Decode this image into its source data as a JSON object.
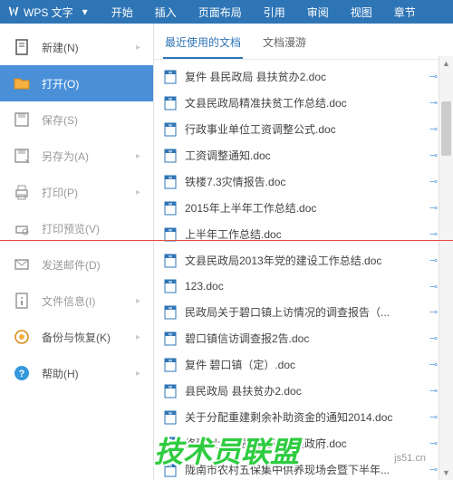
{
  "ribbon": {
    "app_name": "WPS 文字",
    "tabs": [
      "开始",
      "插入",
      "页面布局",
      "引用",
      "审阅",
      "视图",
      "章节"
    ]
  },
  "sidebar": {
    "items": [
      {
        "icon": "new",
        "label": "新建(N)",
        "enabled": true,
        "arrow": true
      },
      {
        "icon": "open",
        "label": "打开(O)",
        "enabled": true,
        "active": true
      },
      {
        "icon": "save",
        "label": "保存(S)",
        "enabled": false,
        "arrow": false
      },
      {
        "icon": "saveas",
        "label": "另存为(A)",
        "enabled": false,
        "arrow": true
      },
      {
        "icon": "print",
        "label": "打印(P)",
        "enabled": false,
        "arrow": true
      },
      {
        "icon": "preview",
        "label": "打印预览(V)",
        "enabled": false,
        "arrow": false
      },
      {
        "icon": "send",
        "label": "发送邮件(D)",
        "enabled": false,
        "arrow": false
      },
      {
        "icon": "info",
        "label": "文件信息(I)",
        "enabled": false,
        "arrow": true
      },
      {
        "icon": "backup",
        "label": "备份与恢复(K)",
        "enabled": true,
        "arrow": true
      },
      {
        "icon": "help",
        "label": "帮助(H)",
        "enabled": true,
        "arrow": true
      }
    ]
  },
  "content": {
    "tabs": [
      {
        "label": "最近使用的文档",
        "active": true
      },
      {
        "label": "文档漫游",
        "active": false
      }
    ],
    "docs": [
      "复件 县民政局   县扶贫办2.doc",
      "文县民政局精准扶贫工作总结.doc",
      "行政事业单位工资调整公式.doc",
      "工资调整通知.doc",
      "铁楼7.3灾情报告.doc",
      "2015年上半年工作总结.doc",
      "上半年工作总结.doc",
      "文县民政局2013年党的建设工作总结.doc",
      "123.doc",
      "民政局关于碧口镇上访情况的调查报告（...",
      "碧口镇信访调查报2告.doc",
      "复件 碧口镇（定）.doc",
      "县民政局   县扶贫办2.doc",
      "关于分配重建剩余补助资金的通知2014.doc",
      "修建烈士陵园选址请示县政府.doc",
      "陇南市农村五保集中供养现场会暨下半年..."
    ]
  },
  "watermark": {
    "main": "技术员联盟",
    "sub": "js51.cn"
  }
}
